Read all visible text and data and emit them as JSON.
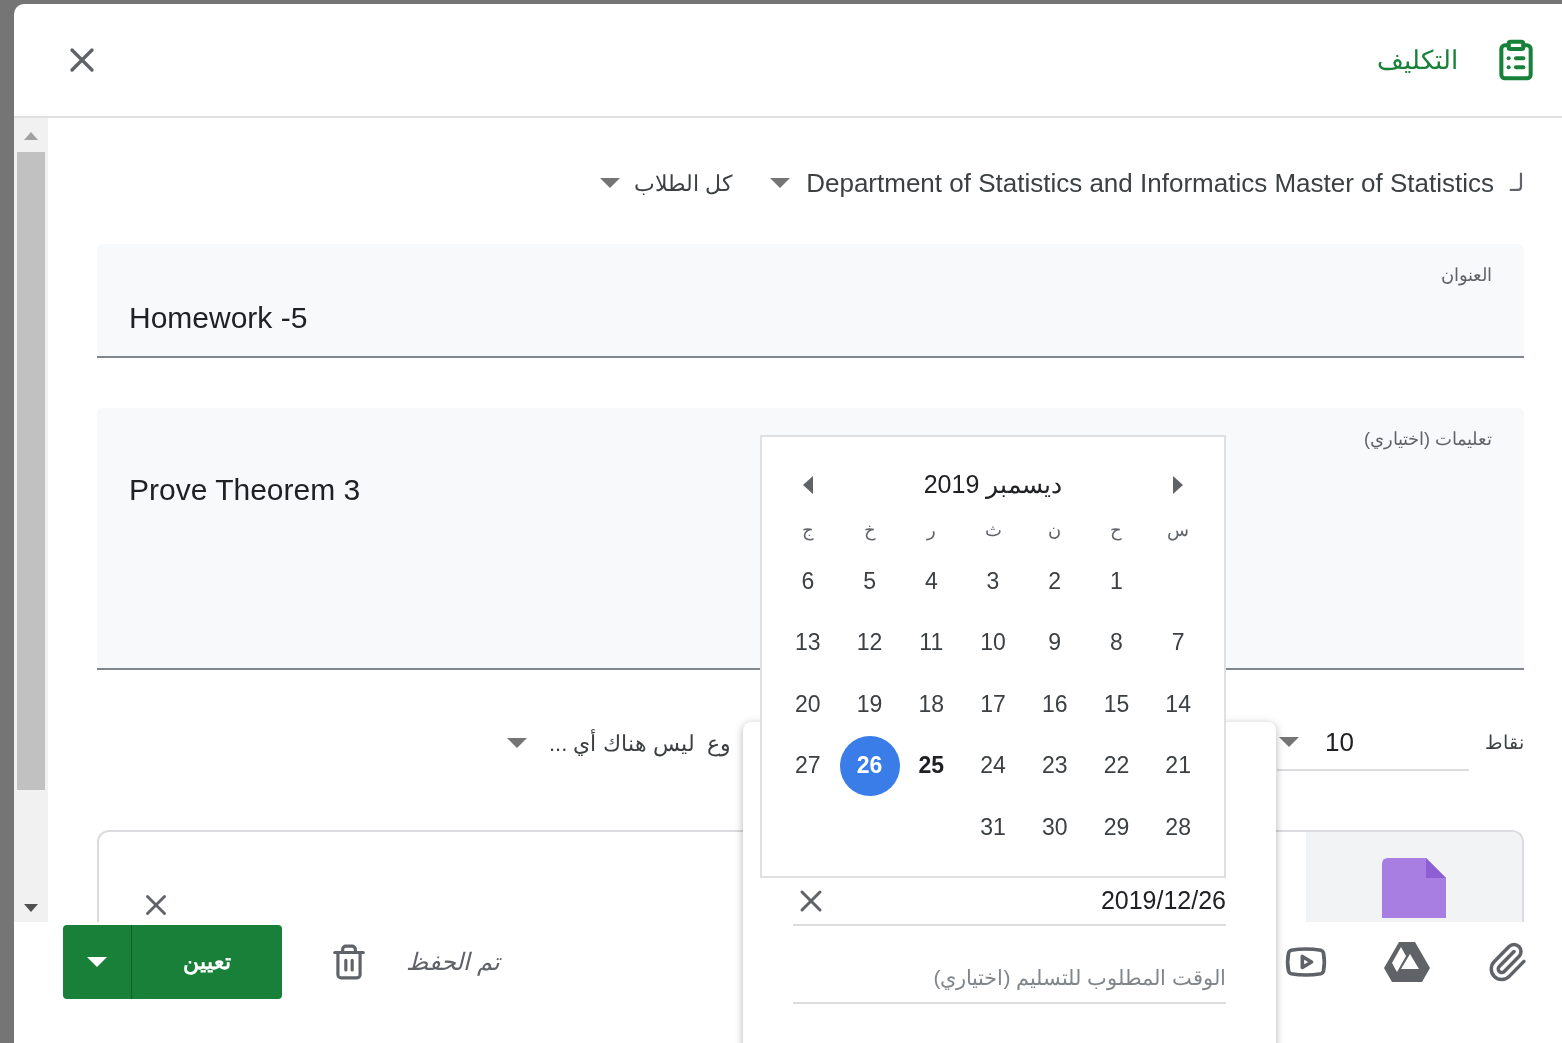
{
  "dialog": {
    "title": "التكليف"
  },
  "recipients": {
    "prefix": "لـ",
    "class_name": "Department of Statistics and Informatics Master of Statistics",
    "students": "كل الطلاب"
  },
  "title_field": {
    "label": "العنوان",
    "value": "Homework -5"
  },
  "instructions_field": {
    "label": "تعليمات (اختياري)",
    "value": "Prove Theorem 3"
  },
  "points": {
    "label": "نقاط",
    "value": "10"
  },
  "topic": {
    "label": "وع",
    "value": "ليس هناك أي ..."
  },
  "footer": {
    "assign_button": "تعيين",
    "status": "تم الحفظ"
  },
  "due_date": {
    "date": "2019/12/26",
    "time_placeholder": "الوقت المطلوب للتسليم (اختياري)"
  },
  "calendar": {
    "month": "ديسمبر 2019",
    "weekdays": [
      "س",
      "ح",
      "ن",
      "ث",
      "ر",
      "خ",
      "ج"
    ],
    "weeks": [
      [
        {
          "day": "1",
          "selected": false,
          "today": false
        },
        {
          "day": "2",
          "selected": false,
          "today": false
        },
        {
          "day": "3",
          "selected": false,
          "today": false
        },
        {
          "day": "4",
          "selected": false,
          "today": false
        },
        {
          "day": "5",
          "selected": false,
          "today": false
        },
        {
          "day": "6",
          "selected": false,
          "today": false
        }
      ],
      [
        {
          "day": "7",
          "selected": false,
          "today": false
        },
        {
          "day": "8",
          "selected": false,
          "today": false
        },
        {
          "day": "9",
          "selected": false,
          "today": false
        },
        {
          "day": "10",
          "selected": false,
          "today": false
        },
        {
          "day": "11",
          "selected": false,
          "today": false
        },
        {
          "day": "12",
          "selected": false,
          "today": false
        },
        {
          "day": "13",
          "selected": false,
          "today": false
        }
      ],
      [
        {
          "day": "14",
          "selected": false,
          "today": false
        },
        {
          "day": "15",
          "selected": false,
          "today": false
        },
        {
          "day": "16",
          "selected": false,
          "today": false
        },
        {
          "day": "17",
          "selected": false,
          "today": false
        },
        {
          "day": "18",
          "selected": false,
          "today": false
        },
        {
          "day": "19",
          "selected": false,
          "today": false
        },
        {
          "day": "20",
          "selected": false,
          "today": false
        }
      ],
      [
        {
          "day": "21",
          "selected": false,
          "today": false
        },
        {
          "day": "22",
          "selected": false,
          "today": false
        },
        {
          "day": "23",
          "selected": false,
          "today": false
        },
        {
          "day": "24",
          "selected": false,
          "today": false
        },
        {
          "day": "25",
          "selected": false,
          "today": true
        },
        {
          "day": "26",
          "selected": true,
          "today": false
        },
        {
          "day": "27",
          "selected": false,
          "today": false
        }
      ],
      [
        {
          "day": "28",
          "selected": false,
          "today": false
        },
        {
          "day": "29",
          "selected": false,
          "today": false
        },
        {
          "day": "30",
          "selected": false,
          "today": false
        },
        {
          "day": "31",
          "selected": false,
          "today": false
        }
      ]
    ]
  }
}
